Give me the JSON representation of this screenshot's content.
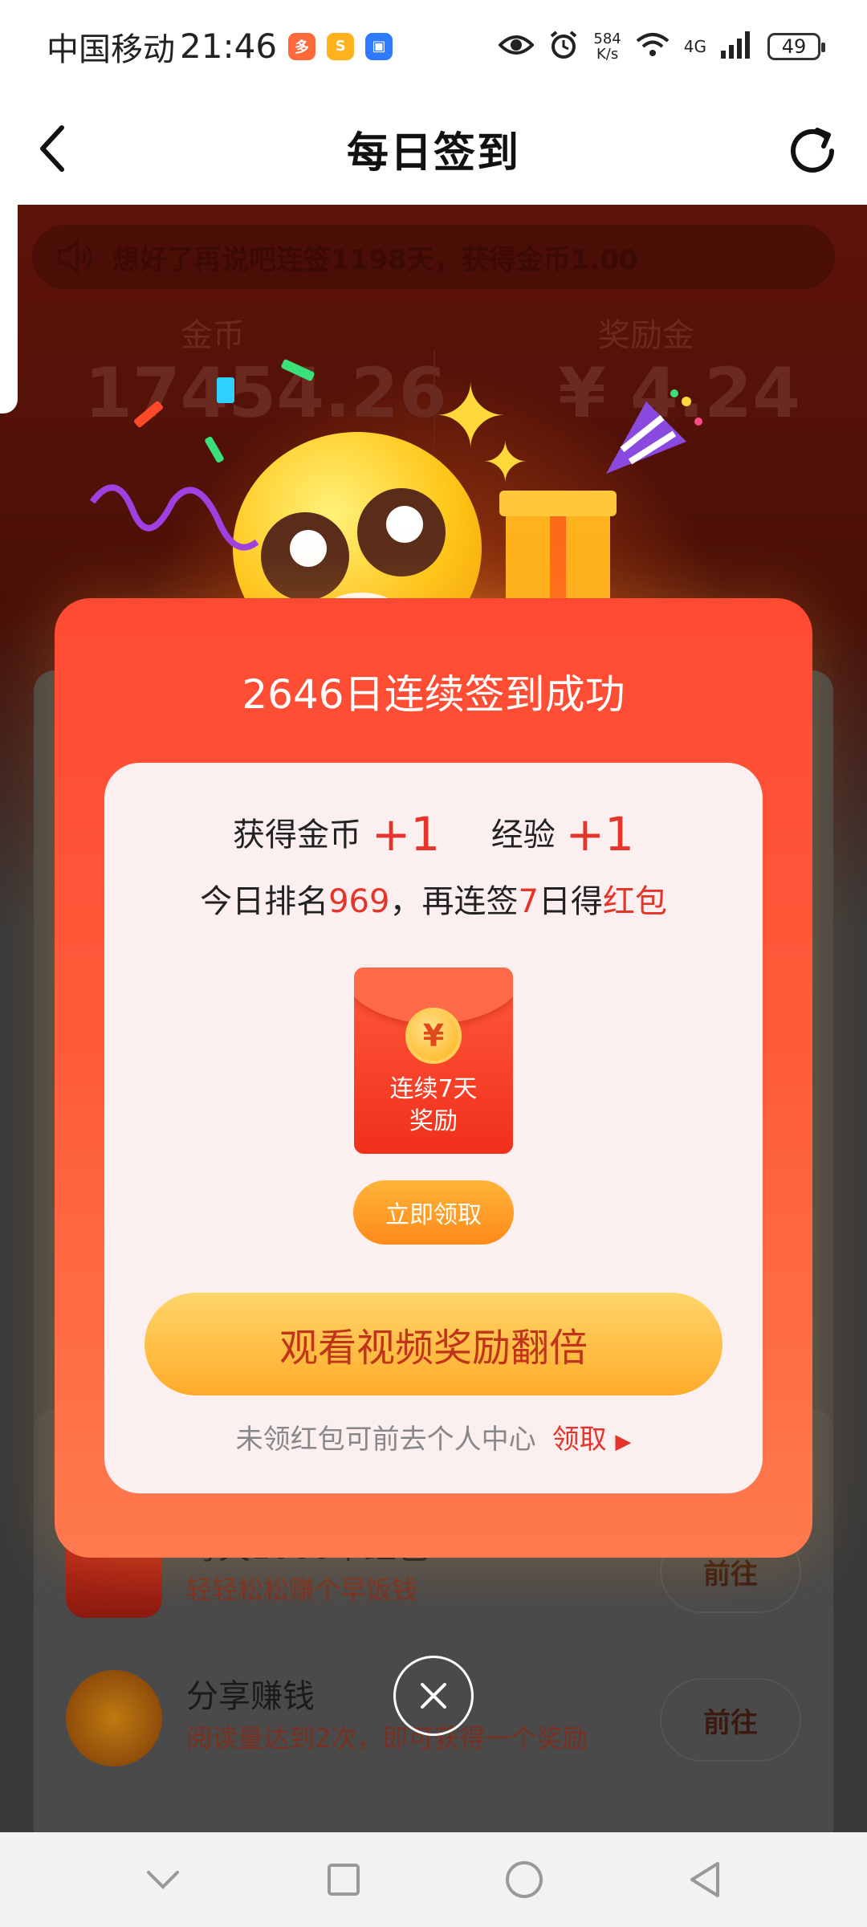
{
  "status_bar": {
    "carrier": "中国移动",
    "time": "21:46",
    "net_speed_top": "584",
    "net_speed_bottom": "K/s",
    "network": "4G",
    "battery": "49",
    "app_icons": [
      {
        "name": "app-icon-1",
        "color": "#ff6a3a",
        "glyph": "多"
      },
      {
        "name": "app-icon-2",
        "color": "#ffb21c",
        "glyph": "S"
      },
      {
        "name": "app-icon-3",
        "color": "#2f7bff",
        "glyph": "▣"
      }
    ]
  },
  "header": {
    "title": "每日签到",
    "back_icon": "back-arrow-icon",
    "refresh_icon": "refresh-icon"
  },
  "background": {
    "notice": "想好了再说吧连签1198天，获得金币1.00",
    "coins_label": "金币",
    "coins_value": "17454.26",
    "bonus_label": "奖励金",
    "bonus_value": "¥ 4.24",
    "list_rows": [
      {
        "title": "每天1000个红包",
        "subtitle": "轻轻松松赚个早饭钱",
        "button": "前往"
      },
      {
        "title": "分享赚钱",
        "subtitle": "阅读量达到2次，即可获得一个奖励",
        "button": "前往"
      }
    ]
  },
  "modal": {
    "title": "2646日连续签到成功",
    "coins_text": "获得金币",
    "coins_plus": "+1",
    "exp_text": "经验",
    "exp_plus": "+1",
    "rank_prefix": "今日排名",
    "rank_value": "969",
    "rank_mid": "，再连签",
    "days_value": "7",
    "days_suffix": "日得",
    "reward_word": "红包",
    "redpack_text": "连续7天\n奖励",
    "redpack_symbol": "¥",
    "claim_button": "立即领取",
    "watch_button": "观看视频奖励翻倍",
    "hint": "未领红包可前去个人中心",
    "hint_link": "领取",
    "hint_link_arrow": "▶"
  },
  "colors": {
    "accent_red": "#e5342a",
    "modal_red": "#ff4a33",
    "gold": "#ffab2a"
  }
}
